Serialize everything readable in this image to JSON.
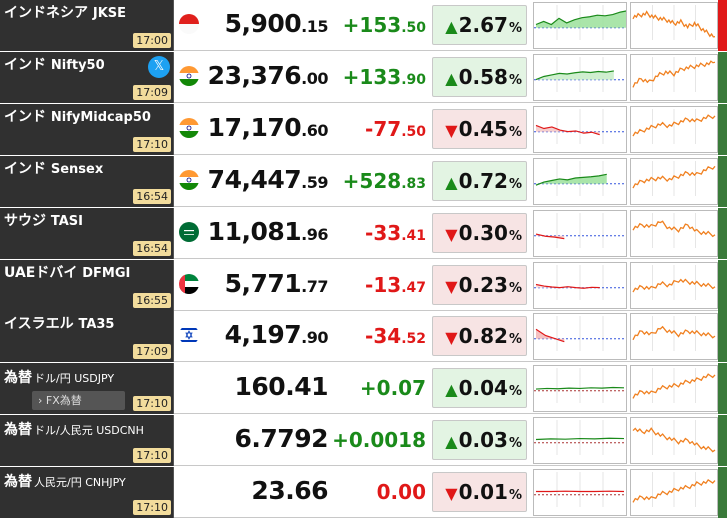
{
  "colors": {
    "up": "#1a8a1a",
    "down": "#e01818",
    "up_bg": "#e3f4e3",
    "down_bg": "#f7e4e4",
    "name_bg": "#303030",
    "time_bg": "#f2dc9c",
    "chart_orange": "#f08020"
  },
  "rows": [
    {
      "name": "インドネシア",
      "symbol": "JKSE",
      "time": "17:00",
      "flag_icon": "indonesia-flag-icon",
      "price_int": "5,900",
      "price_dec": ".15",
      "change_int": "+153",
      "change_dec": ".50",
      "arrow": "▲",
      "pct": "2.67",
      "pct_unit": "%",
      "dir": "up",
      "spark": [
        0.5,
        0.6,
        0.5,
        0.7,
        0.55,
        0.65,
        0.72,
        0.75,
        0.8,
        0.78,
        0.82,
        0.9,
        0.95
      ],
      "spark_fill": "#9be09b",
      "long": [
        0.7,
        0.75,
        0.8,
        0.7,
        0.65,
        0.6,
        0.5,
        0.55,
        0.4,
        0.5,
        0.35,
        0.2,
        0.1
      ]
    },
    {
      "name": "インド",
      "symbol": "Nifty50",
      "time": "17:09",
      "flag_icon": "india-flag-icon",
      "x_icon": "x-share-icon",
      "x_glyph": "𝕏",
      "price_int": "23,376",
      "price_dec": ".00",
      "change_int": "+133",
      "change_dec": ".90",
      "arrow": "▲",
      "pct": "0.58",
      "pct_unit": "%",
      "dir": "up",
      "spark": [
        0.4,
        0.5,
        0.55,
        0.6,
        0.58,
        0.62,
        0.65,
        0.63,
        0.66,
        0.64,
        0.68
      ],
      "spark_fill": "#c7ecc7",
      "long": [
        0.2,
        0.4,
        0.3,
        0.5,
        0.6,
        0.55,
        0.7,
        0.75,
        0.8,
        0.85,
        0.9
      ]
    },
    {
      "name": "インド",
      "symbol": "NifyMidcap50",
      "time": "17:10",
      "flag_icon": "india-flag-icon",
      "price_int": "17,170",
      "price_dec": ".60",
      "change_int": "-77",
      "change_dec": ".50",
      "arrow": "▼",
      "pct": "0.45",
      "pct_unit": "%",
      "dir": "down",
      "spark": [
        0.6,
        0.5,
        0.55,
        0.45,
        0.4,
        0.42,
        0.35,
        0.38,
        0.3
      ],
      "spark_fill": "#f3c6c6",
      "long": [
        0.3,
        0.4,
        0.5,
        0.6,
        0.55,
        0.65,
        0.75,
        0.7,
        0.8,
        0.85
      ]
    },
    {
      "name": "インド",
      "symbol": "Sensex",
      "time": "16:54",
      "flag_icon": "india-flag-icon",
      "price_int": "74,447",
      "price_dec": ".59",
      "change_int": "+528",
      "change_dec": ".83",
      "arrow": "▲",
      "pct": "0.72",
      "pct_unit": "%",
      "dir": "up",
      "spark": [
        0.35,
        0.45,
        0.5,
        0.55,
        0.52,
        0.58,
        0.6,
        0.62,
        0.65,
        0.7
      ],
      "spark_fill": "#9be09b",
      "long": [
        0.3,
        0.45,
        0.5,
        0.55,
        0.5,
        0.6,
        0.7,
        0.65,
        0.8,
        0.9
      ]
    },
    {
      "name": "サウジ",
      "symbol": "TASI",
      "time": "16:54",
      "flag_icon": "saudi-flag-icon",
      "price_int": "11,081",
      "price_dec": ".96",
      "change_int": "-33",
      "change_dec": ".41",
      "arrow": "▼",
      "pct": "0.30",
      "pct_unit": "%",
      "dir": "down",
      "spark": [
        0.45,
        0.38,
        0.35,
        0.3
      ],
      "spark_fill": "#f3c6c6",
      "long": [
        0.6,
        0.7,
        0.65,
        0.8,
        0.6,
        0.55,
        0.7,
        0.5,
        0.45,
        0.4
      ]
    },
    {
      "name": "UAEドバイ",
      "symbol": "DFMGI",
      "time": "16:55",
      "flag_icon": "uae-flag-icon",
      "price_int": "5,771",
      "price_dec": ".77",
      "change_int": "-13",
      "change_dec": ".47",
      "arrow": "▼",
      "pct": "0.23",
      "pct_unit": "%",
      "dir": "down",
      "spark": [
        0.5,
        0.45,
        0.42,
        0.4,
        0.43,
        0.4,
        0.38,
        0.41,
        0.4
      ],
      "spark_fill": "#f7d7d7",
      "long": [
        0.3,
        0.4,
        0.35,
        0.5,
        0.45,
        0.6,
        0.55,
        0.5,
        0.45,
        0.4
      ]
    },
    {
      "name": "イスラエル",
      "symbol": "TA35",
      "time": "17:09",
      "flag_icon": "israel-flag-icon",
      "price_int": "4,197",
      "price_dec": ".90",
      "change_int": "-34",
      "change_dec": ".52",
      "arrow": "▼",
      "pct": "0.82",
      "pct_unit": "%",
      "dir": "down",
      "spark": [
        0.7,
        0.5,
        0.4,
        0.3
      ],
      "spark_fill": "#f3b6b6",
      "long": [
        0.4,
        0.6,
        0.5,
        0.7,
        0.6,
        0.5,
        0.6,
        0.55,
        0.5,
        0.45
      ]
    },
    {
      "name": "為替",
      "symbol": "ドル/円 USDJPY",
      "time": "17:10",
      "fx_button": "FX為替",
      "price_int": "160.41",
      "price_dec": "",
      "change_int": "+0.07",
      "change_dec": "",
      "arrow": "▲",
      "pct": "0.04",
      "pct_unit": "%",
      "dir": "up",
      "spark": [
        0.45,
        0.47,
        0.46,
        0.48,
        0.47,
        0.49,
        0.48,
        0.5,
        0.49
      ],
      "spark_fill": "",
      "long": [
        0.2,
        0.35,
        0.3,
        0.45,
        0.5,
        0.55,
        0.65,
        0.7,
        0.8,
        0.85
      ]
    },
    {
      "name": "為替",
      "symbol": "ドル/人民元 USDCNH",
      "time": "17:10",
      "price_int": "6.7792",
      "price_dec": "",
      "change_int": "+0.0018",
      "change_dec": "",
      "arrow": "▲",
      "pct": "0.03",
      "pct_unit": "%",
      "dir": "up",
      "spark": [
        0.5,
        0.52,
        0.51,
        0.53,
        0.52,
        0.54,
        0.53
      ],
      "spark_fill": "",
      "long": [
        0.8,
        0.7,
        0.75,
        0.6,
        0.5,
        0.4,
        0.45,
        0.3,
        0.2,
        0.15
      ]
    },
    {
      "name": "為替",
      "symbol": "人民元/円 CNHJPY",
      "time": "17:10",
      "price_int": "23.66",
      "price_dec": "",
      "change_int": "0.00",
      "change_dec": "",
      "arrow": "▼",
      "pct": "0.01",
      "pct_unit": "%",
      "dir": "down",
      "spark": [
        0.5,
        0.5,
        0.51,
        0.5,
        0.5,
        0.51,
        0.5
      ],
      "spark_fill": "",
      "long": [
        0.2,
        0.3,
        0.25,
        0.4,
        0.45,
        0.55,
        0.6,
        0.7,
        0.75,
        0.8
      ]
    }
  ]
}
